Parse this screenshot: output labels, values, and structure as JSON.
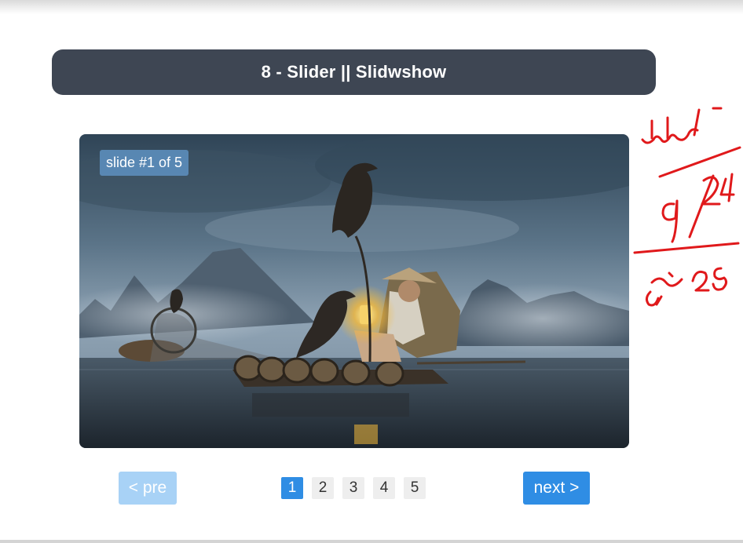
{
  "header": {
    "title": "8 - Slider || Slidwshow"
  },
  "slider": {
    "counter": "slide #1 of 5",
    "current": 1,
    "total": 5,
    "image": "fisherman-with-cormorants-on-bamboo-raft"
  },
  "pagination": {
    "prev_label": "< pre",
    "next_label": "next >",
    "pages": [
      "1",
      "2",
      "3",
      "4",
      "5"
    ],
    "active_page": "1"
  },
  "annotation": {
    "day": "السبت",
    "date": "9/24",
    "note": "28 جزع"
  },
  "colors": {
    "header_bg": "#3e4653",
    "accent": "#2f8de4",
    "disabled_accent": "#a8d2f6",
    "counter_bg": "#5b8cba",
    "ink": "#e0191b"
  }
}
